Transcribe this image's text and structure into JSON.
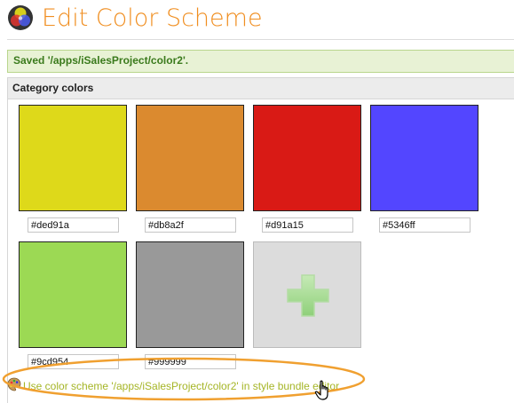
{
  "header": {
    "title": "Edit Color Scheme",
    "icon": "color-wheel-icon"
  },
  "notice": {
    "text": "Saved '/apps/iSalesProject/color2'."
  },
  "panel": {
    "title": "Category colors",
    "swatches": [
      {
        "color": "#ded91a",
        "value": "#ded91a"
      },
      {
        "color": "#db8a2f",
        "value": "#db8a2f"
      },
      {
        "color": "#d91a15",
        "value": "#d91a15"
      },
      {
        "color": "#5346ff",
        "value": "#5346ff"
      },
      {
        "color": "#9cd954",
        "value": "#9cd954"
      },
      {
        "color": "#999999",
        "value": "#999999"
      }
    ],
    "add_icon": "plus-icon"
  },
  "link": {
    "text": "Use color scheme '/apps/iSalesProject/color2' in style bundle editor.",
    "icon": "palette-icon"
  },
  "colors": {
    "title": "#f08e20",
    "success_text": "#3a7a1c",
    "link": "#a5b526",
    "highlight": "#f0a030"
  }
}
